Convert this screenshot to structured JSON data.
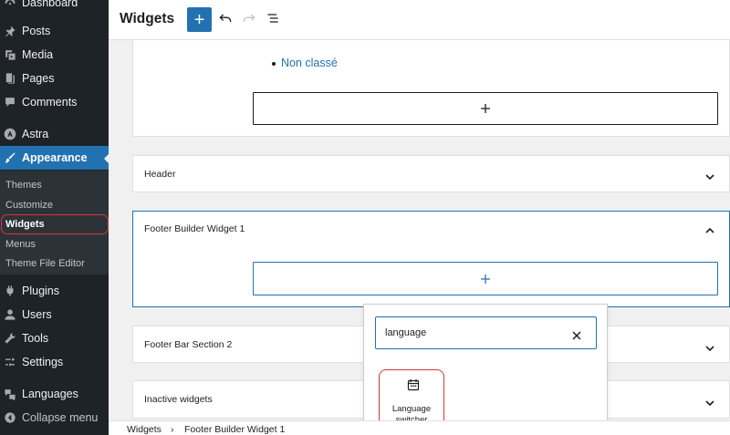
{
  "sidebar": {
    "top_item": {
      "label": "Dashboard",
      "icon": "dashboard-icon"
    },
    "items": [
      {
        "label": "Posts",
        "icon": "pin-icon"
      },
      {
        "label": "Media",
        "icon": "media-icon"
      },
      {
        "label": "Pages",
        "icon": "pages-icon"
      },
      {
        "label": "Comments",
        "icon": "comment-icon"
      },
      {
        "label": "Astra",
        "icon": "astra-icon"
      },
      {
        "label": "Appearance",
        "icon": "brush-icon"
      },
      {
        "label": "Plugins",
        "icon": "plug-icon"
      },
      {
        "label": "Users",
        "icon": "users-icon"
      },
      {
        "label": "Tools",
        "icon": "wrench-icon"
      },
      {
        "label": "Settings",
        "icon": "settings-icon"
      },
      {
        "label": "Languages",
        "icon": "translate-icon"
      },
      {
        "label": "Collapse menu",
        "icon": "collapse-icon"
      }
    ],
    "submenu": [
      "Themes",
      "Customize",
      "Widgets",
      "Menus",
      "Theme File Editor"
    ],
    "highlight_color": "#d63638",
    "active_color": "#2271b1"
  },
  "header": {
    "title": "Widgets",
    "add_label": "+"
  },
  "canvas": {
    "category_link": "Non classé",
    "plus_symbol": "+",
    "panels": [
      {
        "title": "Header",
        "state": "collapsed"
      },
      {
        "title": "Footer Builder Widget 1",
        "state": "expanded"
      },
      {
        "title": "Footer Bar Section 2",
        "state": "collapsed"
      },
      {
        "title": "Inactive widgets",
        "state": "collapsed"
      }
    ]
  },
  "inserter": {
    "search_value": "language",
    "result": {
      "label": "Language switcher",
      "icon": "calendar-icon"
    }
  },
  "breadcrumb": {
    "items": [
      "Widgets",
      "Footer Builder Widget 1"
    ],
    "separator": "›"
  }
}
